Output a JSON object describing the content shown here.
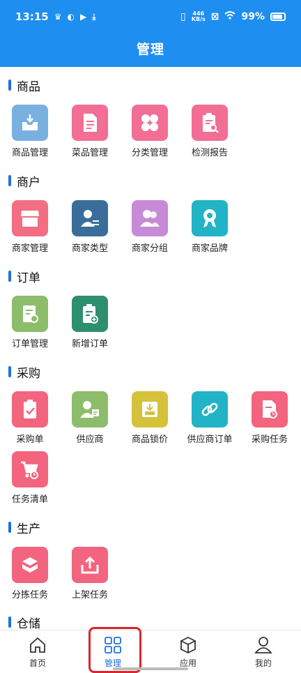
{
  "status_bar": {
    "time": "13:15",
    "net_speed_top": "446",
    "net_speed_bottom": "KB/s",
    "battery": "99%"
  },
  "header": {
    "title": "管理"
  },
  "sections": [
    {
      "title": "商品",
      "items": [
        {
          "label": "商品管理",
          "icon": "inbox-tray-icon",
          "color": "#7ab0e0"
        },
        {
          "label": "菜品管理",
          "icon": "document-icon",
          "color": "#f36e94"
        },
        {
          "label": "分类管理",
          "icon": "category-grid-icon",
          "color": "#f36e94"
        },
        {
          "label": "检测报告",
          "icon": "report-search-icon",
          "color": "#f36e94"
        }
      ]
    },
    {
      "title": "商户",
      "items": [
        {
          "label": "商家管理",
          "icon": "store-icon",
          "color": "#f36e82"
        },
        {
          "label": "商家类型",
          "icon": "user-swap-icon",
          "color": "#3a6d9a"
        },
        {
          "label": "商家分组",
          "icon": "user-group-icon",
          "color": "#c78ad6"
        },
        {
          "label": "商家品牌",
          "icon": "ribbon-badge-icon",
          "color": "#21b3c6"
        }
      ]
    },
    {
      "title": "订单",
      "items": [
        {
          "label": "订单管理",
          "icon": "order-settings-icon",
          "color": "#8dbd6a"
        },
        {
          "label": "新增订单",
          "icon": "clipboard-add-icon",
          "color": "#2e8f6e"
        }
      ]
    },
    {
      "title": "采购",
      "items": [
        {
          "label": "采购单",
          "icon": "clipboard-check-icon",
          "color": "#f3647e"
        },
        {
          "label": "供应商",
          "icon": "supplier-card-icon",
          "color": "#8dbd6a"
        },
        {
          "label": "商品锁价",
          "icon": "lock-box-icon",
          "color": "#d5c23a"
        },
        {
          "label": "供应商订单",
          "icon": "link-icon",
          "color": "#21b3c6"
        },
        {
          "label": "采购任务",
          "icon": "task-clock-icon",
          "color": "#f3647e"
        },
        {
          "label": "任务清单",
          "icon": "cart-clock-icon",
          "color": "#f3647e"
        }
      ]
    },
    {
      "title": "生产",
      "items": [
        {
          "label": "分拣任务",
          "icon": "boxes-icon",
          "color": "#f3647e"
        },
        {
          "label": "上架任务",
          "icon": "upload-tray-icon",
          "color": "#f3647e"
        }
      ]
    },
    {
      "title": "仓储",
      "items": []
    }
  ],
  "tabbar": [
    {
      "label": "首页",
      "icon": "home-icon",
      "active": false
    },
    {
      "label": "管理",
      "icon": "grid-icon",
      "active": true
    },
    {
      "label": "应用",
      "icon": "cube-icon",
      "active": false
    },
    {
      "label": "我的",
      "icon": "user-icon",
      "active": false
    }
  ]
}
